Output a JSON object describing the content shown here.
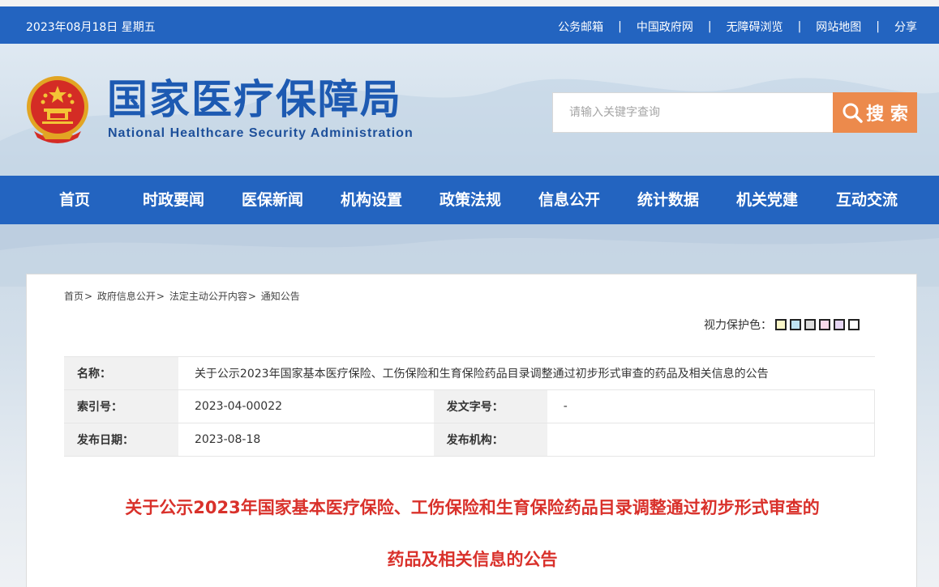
{
  "topbar": {
    "date": "2023年08月18日 星期五",
    "links": [
      "公务邮箱",
      "中国政府网",
      "无障碍浏览",
      "网站地图",
      "分享"
    ],
    "separator": "|"
  },
  "header": {
    "title": "国家医疗保障局",
    "subtitle": "National Healthcare Security Administration"
  },
  "search": {
    "placeholder": "请输入关键字查询",
    "button_label": "搜 索"
  },
  "nav": [
    "首页",
    "时政要闻",
    "医保新闻",
    "机构设置",
    "政策法规",
    "信息公开",
    "统计数据",
    "机关党建",
    "互动交流"
  ],
  "breadcrumb": [
    "首页",
    "政府信息公开",
    "法定主动公开内容",
    "通知公告"
  ],
  "breadcrumb_sep": ">",
  "vision": {
    "label": "视力保护色：",
    "colors": [
      "#faf6c8",
      "#bfe3f3",
      "#dcdcdc",
      "#f7d9e8",
      "#e6d6f3",
      "#ffffff"
    ]
  },
  "meta": {
    "name_label": "名称：",
    "name_value": "关于公示2023年国家基本医疗保险、工伤保险和生育保险药品目录调整通过初步形式审查的药品及相关信息的公告",
    "index_label": "索引号：",
    "index_value": "2023-04-00022",
    "docno_label": "发文字号：",
    "docno_value": "-",
    "date_label": "发布日期：",
    "date_value": "2023-08-18",
    "org_label": "发布机构：",
    "org_value": ""
  },
  "article": {
    "title_line1": "关于公示2023年国家基本医疗保险、工伤保险和生育保险药品目录调整通过初步形式审查的",
    "title_line2": "药品及相关信息的公告"
  },
  "colors": {
    "brand_blue": "#2364c0",
    "search_orange": "#ec8a4c",
    "title_red": "#d9312b"
  }
}
